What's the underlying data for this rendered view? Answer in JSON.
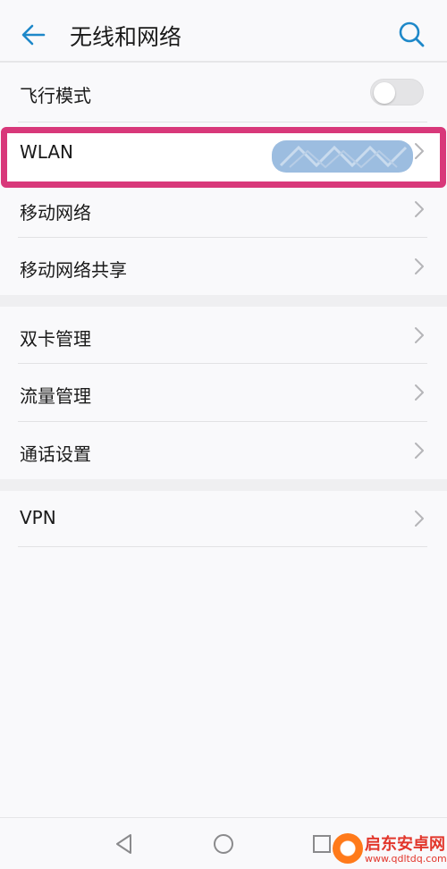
{
  "header": {
    "title": "无线和网络",
    "back_icon": "back-arrow-icon",
    "search_icon": "search-icon",
    "accent_color": "#1e88c9"
  },
  "sections": [
    {
      "items": [
        {
          "label": "飞行模式",
          "control": "toggle",
          "toggle_on": false
        },
        {
          "label": "WLAN",
          "control": "chevron",
          "value_redacted": true,
          "highlighted": true
        },
        {
          "label": "移动网络",
          "control": "chevron"
        },
        {
          "label": "移动网络共享",
          "control": "chevron"
        }
      ]
    },
    {
      "items": [
        {
          "label": "双卡管理",
          "control": "chevron"
        },
        {
          "label": "流量管理",
          "control": "chevron"
        },
        {
          "label": "通话设置",
          "control": "chevron"
        }
      ]
    },
    {
      "items": [
        {
          "label": "VPN",
          "control": "chevron"
        }
      ]
    }
  ],
  "highlight_color": "#d8387a",
  "navbar": {
    "icons": [
      "nav-back-icon",
      "nav-home-icon",
      "nav-recent-icon"
    ]
  },
  "watermark": {
    "name": "启东安卓网",
    "url": "www.qdltdq.com"
  }
}
